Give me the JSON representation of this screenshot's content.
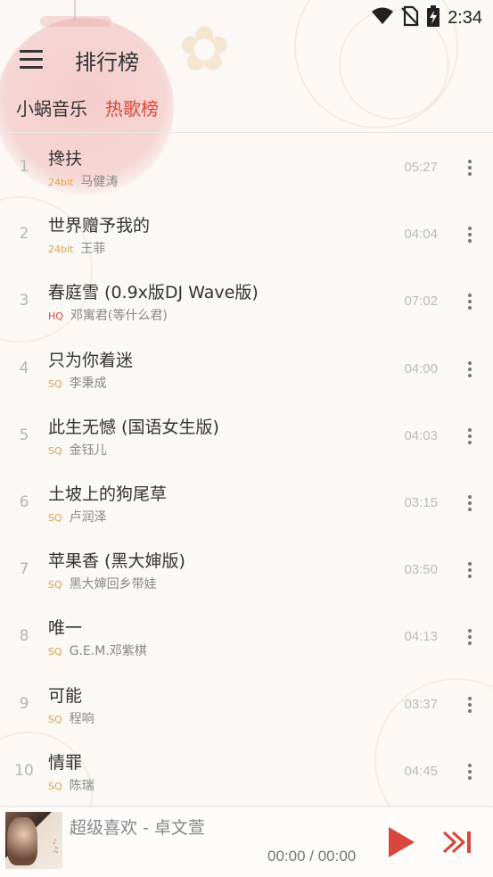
{
  "status_bar": {
    "time": "2:34",
    "icons": [
      "wifi-icon",
      "no-sim-icon",
      "battery-charging-icon"
    ]
  },
  "header": {
    "menu_icon": "hamburger-menu-icon",
    "title": "排行榜"
  },
  "tabs": [
    {
      "label": "小蜗音乐",
      "active": false
    },
    {
      "label": "热歌榜",
      "active": true
    }
  ],
  "songs": [
    {
      "rank": "1",
      "title": "搀扶",
      "quality": "24bit",
      "artist": "马健涛",
      "duration": "05:27"
    },
    {
      "rank": "2",
      "title": "世界赠予我的",
      "quality": "24bit",
      "artist": "王菲",
      "duration": "04:04"
    },
    {
      "rank": "3",
      "title": "春庭雪 (0.9x版DJ Wave版)",
      "quality": "HQ",
      "artist": "邓寓君(等什么君)",
      "duration": "07:02"
    },
    {
      "rank": "4",
      "title": "只为你着迷",
      "quality": "SQ",
      "artist": "李秉成",
      "duration": "04:00"
    },
    {
      "rank": "5",
      "title": "此生无憾 (国语女生版)",
      "quality": "SQ",
      "artist": "金钰儿",
      "duration": "04:03"
    },
    {
      "rank": "6",
      "title": "土坡上的狗尾草",
      "quality": "SQ",
      "artist": "卢润泽",
      "duration": "03:15"
    },
    {
      "rank": "7",
      "title": "苹果香 (黑大婶版)",
      "quality": "SQ",
      "artist": "黑大婶回乡带娃",
      "duration": "03:50"
    },
    {
      "rank": "8",
      "title": "唯一",
      "quality": "SQ",
      "artist": "G.E.M.邓紫棋",
      "duration": "04:13"
    },
    {
      "rank": "9",
      "title": "可能",
      "quality": "SQ",
      "artist": "程响",
      "duration": "03:37"
    },
    {
      "rank": "10",
      "title": "情罪",
      "quality": "SQ",
      "artist": "陈瑞",
      "duration": "04:45"
    }
  ],
  "player": {
    "now_playing": "超级喜欢 - 卓文萱",
    "time": "00:00 / 00:00",
    "play_icon": "play-icon",
    "next_icon": "skip-next-icon",
    "accent": "#d9473c"
  }
}
